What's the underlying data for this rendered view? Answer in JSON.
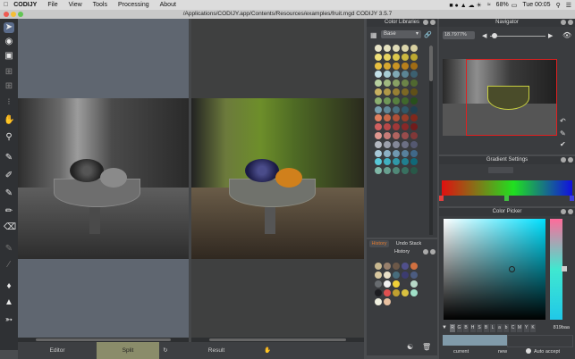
{
  "menubar": {
    "app_name": "CODIJY",
    "items": [
      "File",
      "View",
      "Tools",
      "Processing",
      "About"
    ],
    "battery": "68%",
    "clock": "Tue 00:05"
  },
  "window": {
    "title": "/Applications/CODIJY.app/Contents/Resources/examples/fruit.mgd CODIJY 3.5.7"
  },
  "color_libraries": {
    "title": "Color Libraries",
    "library_select": "Base"
  },
  "navigator": {
    "title": "Navigator",
    "zoom": "18.7977%"
  },
  "gradient_settings": {
    "title": "Gradient Settings"
  },
  "color_picker": {
    "title": "Color Picker",
    "channels": [
      "R",
      "G",
      "B",
      "H",
      "S",
      "B",
      "L",
      "a",
      "b",
      "C",
      "M",
      "Y",
      "K"
    ],
    "hex_value": "819baa",
    "current_label": "current",
    "new_label": "new",
    "auto_accept_label": "Auto accept"
  },
  "history_panel": {
    "tab_history": "History",
    "tab_undo": "Undo Stack",
    "title": "History"
  },
  "bottom_tabs": {
    "editor": "Editor",
    "split": "Split",
    "result": "Result"
  },
  "colors": {
    "accent_split": "#8a8c6a",
    "navigator_frame": "#e02020",
    "picker_current": "#819baa"
  }
}
